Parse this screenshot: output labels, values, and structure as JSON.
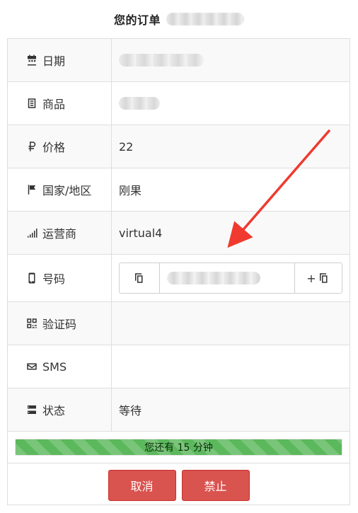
{
  "header": {
    "title": "您的订单"
  },
  "rows": [
    {
      "label": "日期",
      "icon": "calendar-icon"
    },
    {
      "label": "商品",
      "icon": "list-icon"
    },
    {
      "label": "价格",
      "icon": "ruble-icon",
      "value": "22"
    },
    {
      "label": "国家/地区",
      "icon": "flag-icon",
      "value": "刚果"
    },
    {
      "label": "运营商",
      "icon": "signal-icon",
      "value": "virtual4"
    },
    {
      "label": "号码",
      "icon": "phone-icon"
    },
    {
      "label": "验证码",
      "icon": "qr-icon"
    },
    {
      "label": "SMS",
      "icon": "envelope-icon"
    },
    {
      "label": "状态",
      "icon": "server-icon",
      "value": "等待"
    }
  ],
  "phone": {
    "copy_left_icon": "copy-icon",
    "copy_right_prefix": "+",
    "copy_right_icon": "copy-icon"
  },
  "progress": {
    "text": "您还有 15 分钟",
    "fraction": 0.99,
    "color": "#5cb85c"
  },
  "actions": {
    "cancel_label": "取消",
    "ban_label": "禁止",
    "color": "#d9534f"
  },
  "annotation": {
    "arrow_color": "#f03a2f"
  }
}
